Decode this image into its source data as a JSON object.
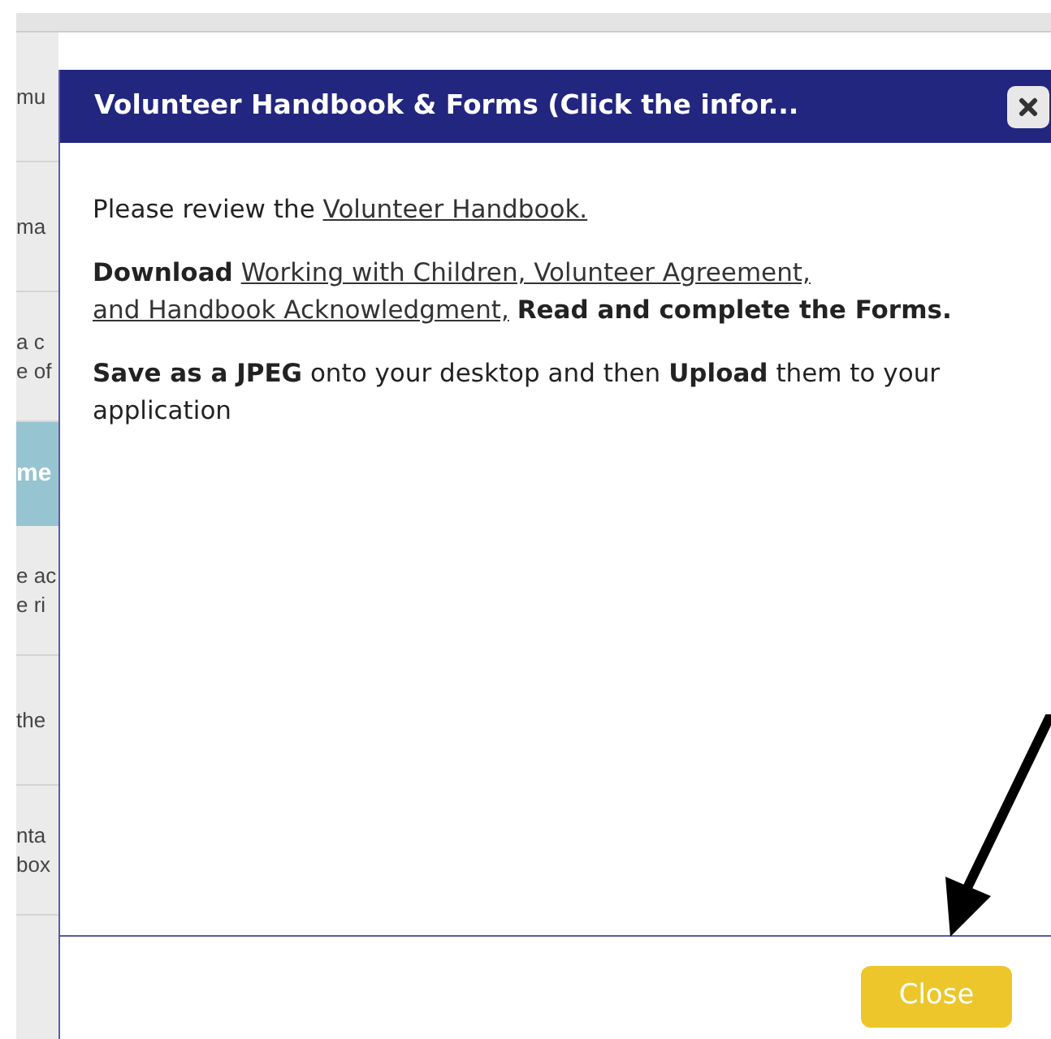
{
  "background_rows": [
    {
      "kind": "plain",
      "lines": [
        "mu"
      ]
    },
    {
      "kind": "plain",
      "lines": [
        "ma"
      ]
    },
    {
      "kind": "plain",
      "lines": [
        "a c",
        "e of"
      ]
    },
    {
      "kind": "band",
      "lines": [
        "me"
      ]
    },
    {
      "kind": "plain",
      "lines": [
        "e ac",
        "e ri"
      ]
    },
    {
      "kind": "plain",
      "lines": [
        "the"
      ]
    },
    {
      "kind": "plain",
      "lines": [
        "nta",
        "box"
      ]
    }
  ],
  "dialog": {
    "title": "Volunteer Handbook & Forms (Click the infor...",
    "paragraphs": [
      [
        {
          "kind": "text",
          "text": "Please review the"
        },
        {
          "kind": "link",
          "text": "Volunteer Handbook."
        }
      ],
      [
        {
          "kind": "bold",
          "text": "Download"
        },
        {
          "kind": "link",
          "text": "Working with Children, Volunteer Agreement,"
        },
        {
          "kind": "link",
          "text": "and Handbook Acknowledgment,"
        },
        {
          "kind": "bold",
          "text": "Read and complete the Forms."
        }
      ],
      [
        {
          "kind": "bold",
          "text": "Save as a JPEG"
        },
        {
          "kind": "text",
          "text": "onto your desktop and then"
        },
        {
          "kind": "bold",
          "text": "Upload"
        },
        {
          "kind": "text",
          "text": "them to your application"
        }
      ]
    ],
    "buttons": [
      "Close"
    ]
  }
}
